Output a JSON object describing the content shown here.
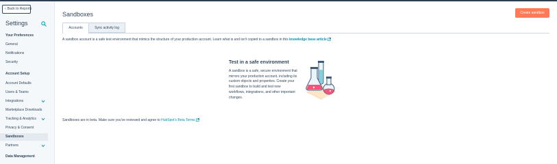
{
  "sidebar": {
    "back_label": "Back to Reports",
    "title": "Settings",
    "sections": [
      {
        "heading": "Your Preferences",
        "items": [
          {
            "label": "General",
            "expandable": false
          },
          {
            "label": "Notifications",
            "expandable": false
          },
          {
            "label": "Security",
            "expandable": false
          }
        ]
      },
      {
        "heading": "Account Setup",
        "items": [
          {
            "label": "Account Defaults",
            "expandable": false
          },
          {
            "label": "Users & Teams",
            "expandable": false
          },
          {
            "label": "Integrations",
            "expandable": true
          },
          {
            "label": "Marketplace Downloads",
            "expandable": false
          },
          {
            "label": "Tracking & Analytics",
            "expandable": true
          },
          {
            "label": "Privacy & Consent",
            "expandable": false
          },
          {
            "label": "Sandboxes",
            "expandable": false,
            "active": true
          },
          {
            "label": "Partners",
            "expandable": true
          }
        ]
      },
      {
        "heading": "Data Management",
        "items": []
      }
    ]
  },
  "header": {
    "title": "Sandboxes",
    "create_button": "Create sandbox"
  },
  "tabs": [
    {
      "label": "Accounts",
      "active": true
    },
    {
      "label": "Sync activity log",
      "active": false
    }
  ],
  "description": {
    "text": "A sandbox account is a safe test environment that mimics the structure of your production account. Learn what is and isn't copied to a sandbox in this ",
    "link": "knowledge base article"
  },
  "empty_state": {
    "title": "Test in a safe environment",
    "body": "A sandbox is a safe, secure environment that mirrors your production account, including its custom objects and properties. Create your first sandbox to build and test new workflows, integrations, and other important changes."
  },
  "beta_note": {
    "text": "Sandboxes are in beta. Make sure you've reviewed and agree to ",
    "link": "HubSpot's Beta Terms"
  },
  "colors": {
    "primary_button": "#ff7a59",
    "link": "#0091ae",
    "text": "#33475b",
    "sidebar_bg": "#f5f8fa",
    "top_bar": "#2d3e50"
  },
  "icons": {
    "back": "chevron-left-icon",
    "search": "search-icon",
    "expand": "chevron-down-icon",
    "external_link": "external-link-icon",
    "illustration": "lab-flasks-illustration"
  }
}
